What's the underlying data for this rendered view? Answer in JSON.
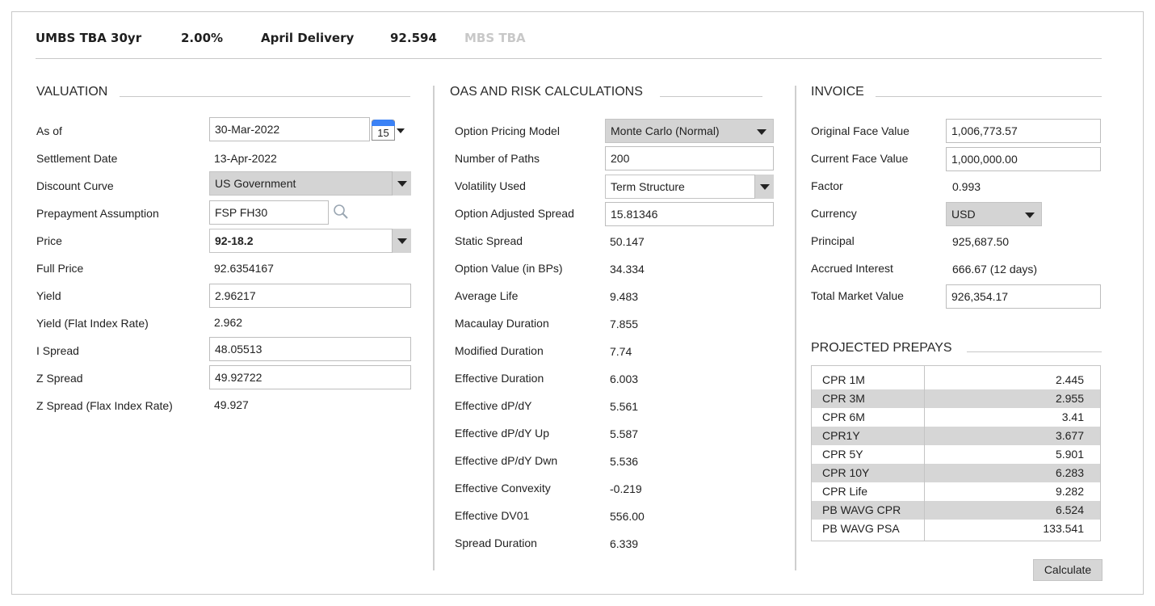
{
  "header": {
    "security": "UMBS TBA 30yr",
    "coupon": "2.00%",
    "delivery": "April Delivery",
    "price": "92.594",
    "type": "MBS TBA"
  },
  "valuation": {
    "title": "VALUATION",
    "as_of_label": "As of",
    "as_of_value": "30-Mar-2022",
    "calendar_day": "15",
    "settlement_label": "Settlement Date",
    "settlement_value": "13-Apr-2022",
    "discount_curve_label": "Discount Curve",
    "discount_curve_value": "US Government",
    "prepay_label": "Prepayment Assumption",
    "prepay_value": "FSP FH30",
    "price_label": "Price",
    "price_value": "92-18.2",
    "full_price_label": "Full Price",
    "full_price_value": "92.6354167",
    "yield_label": "Yield",
    "yield_value": "2.96217",
    "yield_flat_label": "Yield (Flat Index Rate)",
    "yield_flat_value": "2.962",
    "i_spread_label": "I Spread",
    "i_spread_value": "48.05513",
    "z_spread_label": "Z Spread",
    "z_spread_value": "49.92722",
    "z_spread_flat_label": "Z Spread (Flax Index Rate)",
    "z_spread_flat_value": "49.927"
  },
  "oas": {
    "title": "OAS AND RISK CALCULATIONS",
    "model_label": "Option Pricing Model",
    "model_value": "Monte Carlo (Normal)",
    "paths_label": "Number of Paths",
    "paths_value": "200",
    "vol_label": "Volatility Used",
    "vol_value": "Term Structure",
    "oas_label": "Option Adjusted Spread",
    "oas_value": "15.81346",
    "rows": [
      {
        "label": "Static Spread",
        "value": "50.147"
      },
      {
        "label": "Option Value (in BPs)",
        "value": "34.334"
      },
      {
        "label": "Average Life",
        "value": "9.483"
      },
      {
        "label": "Macaulay Duration",
        "value": "7.855"
      },
      {
        "label": "Modified Duration",
        "value": "7.74"
      },
      {
        "label": "Effective Duration",
        "value": "6.003"
      },
      {
        "label": "Effective dP/dY",
        "value": "5.561"
      },
      {
        "label": "Effective dP/dY Up",
        "value": "5.587"
      },
      {
        "label": "Effective dP/dY Dwn",
        "value": "5.536"
      },
      {
        "label": "Effective Convexity",
        "value": "-0.219"
      },
      {
        "label": "Effective DV01",
        "value": "556.00"
      },
      {
        "label": "Spread Duration",
        "value": "6.339"
      }
    ]
  },
  "invoice": {
    "title": "INVOICE",
    "orig_face_label": "Original Face Value",
    "orig_face_value": "1,006,773.57",
    "curr_face_label": "Current Face Value",
    "curr_face_value": "1,000,000.00",
    "factor_label": "Factor",
    "factor_value": "0.993",
    "currency_label": "Currency",
    "currency_value": "USD",
    "principal_label": "Principal",
    "principal_value": "925,687.50",
    "accrued_label": "Accrued Interest",
    "accrued_value": "666.67 (12 days)",
    "total_label": "Total Market Value",
    "total_value": "926,354.17"
  },
  "prepays": {
    "title": "PROJECTED PREPAYS",
    "rows": [
      {
        "label": "CPR 1M",
        "value": "2.445"
      },
      {
        "label": "CPR 3M",
        "value": "2.955"
      },
      {
        "label": "CPR 6M",
        "value": "3.41"
      },
      {
        "label": "CPR1Y",
        "value": "3.677"
      },
      {
        "label": "CPR 5Y",
        "value": "5.901"
      },
      {
        "label": "CPR 10Y",
        "value": "6.283"
      },
      {
        "label": "CPR Life",
        "value": "9.282"
      },
      {
        "label": "PB WAVG CPR",
        "value": "6.524"
      },
      {
        "label": "PB WAVG PSA",
        "value": "133.541"
      }
    ]
  },
  "calculate_label": "Calculate"
}
